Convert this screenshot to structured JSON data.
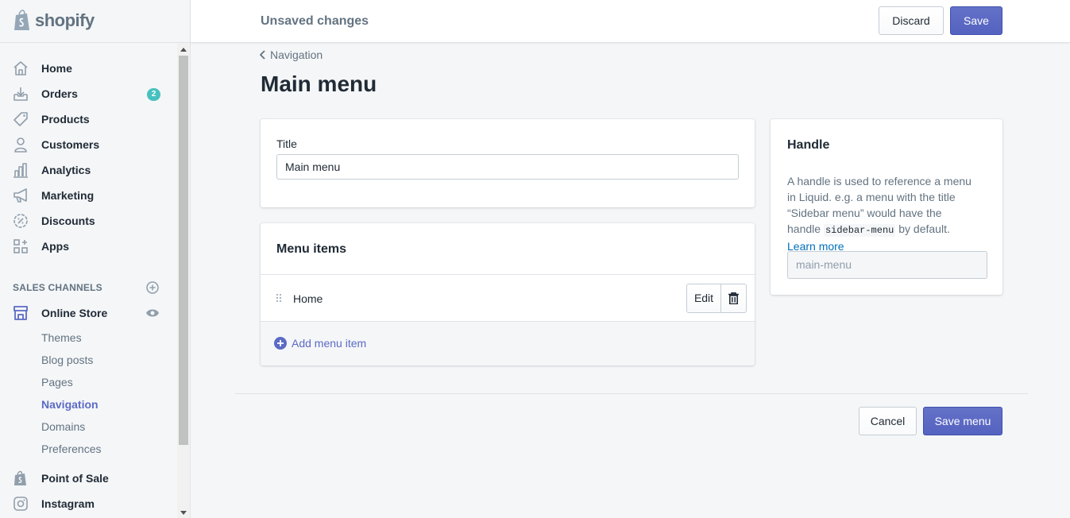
{
  "app": {
    "brand": "shopify"
  },
  "sidebar": {
    "items": [
      {
        "label": "Home",
        "icon": "home-icon"
      },
      {
        "label": "Orders",
        "icon": "orders-icon",
        "badge": "2"
      },
      {
        "label": "Products",
        "icon": "tag-icon"
      },
      {
        "label": "Customers",
        "icon": "person-icon"
      },
      {
        "label": "Analytics",
        "icon": "bar-chart-icon"
      },
      {
        "label": "Marketing",
        "icon": "megaphone-icon"
      },
      {
        "label": "Discounts",
        "icon": "discount-icon"
      },
      {
        "label": "Apps",
        "icon": "apps-icon"
      }
    ],
    "sales_channels_label": "SALES CHANNELS",
    "online_store": {
      "label": "Online Store",
      "subitems": [
        {
          "label": "Themes",
          "active": false
        },
        {
          "label": "Blog posts",
          "active": false
        },
        {
          "label": "Pages",
          "active": false
        },
        {
          "label": "Navigation",
          "active": true
        },
        {
          "label": "Domains",
          "active": false
        },
        {
          "label": "Preferences",
          "active": false
        }
      ]
    },
    "channels": [
      {
        "label": "Point of Sale",
        "icon": "shopify-bag-icon"
      },
      {
        "label": "Instagram",
        "icon": "instagram-icon"
      }
    ]
  },
  "topbar": {
    "status": "Unsaved changes",
    "discard_label": "Discard",
    "save_label": "Save"
  },
  "page": {
    "breadcrumb": "Navigation",
    "title": "Main menu"
  },
  "title_card": {
    "label": "Title",
    "value": "Main menu"
  },
  "menu_card": {
    "heading": "Menu items",
    "items": [
      {
        "label": "Home",
        "edit_label": "Edit"
      }
    ],
    "add_label": "Add menu item"
  },
  "handle_card": {
    "heading": "Handle",
    "help_before": "A handle is used to reference a menu in Liquid. e.g. a menu with the title “Sidebar menu” would have the handle",
    "help_code": "sidebar-menu",
    "help_after": "by default.",
    "learn_more": "Learn more",
    "placeholder": "main-menu"
  },
  "footer": {
    "cancel_label": "Cancel",
    "save_menu_label": "Save menu"
  },
  "colors": {
    "accent": "#5c6ac4",
    "badge": "#47c1bf",
    "link": "#006fbb",
    "muted_text": "#637381"
  }
}
